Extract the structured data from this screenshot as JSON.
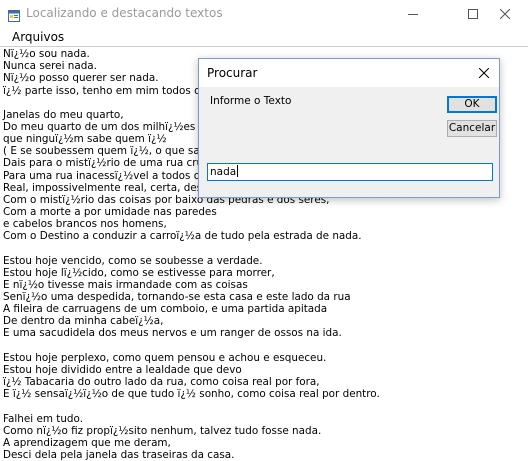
{
  "window": {
    "title": "Localizando e destacando textos",
    "icon": "app-form-icon"
  },
  "menu": {
    "items": [
      {
        "label": "Arquivos"
      }
    ]
  },
  "text_lines": [
    "Nï¿½o sou nada.",
    "Nunca serei nada.",
    "Nï¿½o posso querer ser nada.",
    "ï¿½ parte isso, tenho em mim todos os sonhos do m",
    "",
    "Janelas do meu quarto,",
    "Do meu quarto de um dos milhï¿½es do mundo.",
    "que ninguï¿½m sabe quem ï¿½",
    "( E se soubessem quem ï¿½, o que saberiam?),",
    "Dais para o mistï¿½rio de uma rua cruzada constan",
    "Para uma rua inacessï¿½vel a todos os pensament",
    "Real, impossivelmente real, certa, desconhecidan",
    "Com o mistï¿½rio das coisas por baixo das pedras e dos seres,",
    "Com a morte a por umidade nas paredes",
    "e cabelos brancos nos homens,",
    "Com o Destino a conduzir a carroï¿½a de tudo pela estrada de nada.",
    "",
    "Estou hoje vencido, como se soubesse a verdade.",
    "Estou hoje lï¿½cido, como se estivesse para morrer,",
    "E nï¿½o tivesse mais irmandade com as coisas",
    "Senï¿½o uma despedida, tornando-se esta casa e este lado da rua",
    "A fileira de carruagens de um comboio, e uma partida apitada",
    "De dentro da minha cabeï¿½a,",
    "E uma sacudidela dos meus nervos e um ranger de ossos na ida.",
    "",
    "Estou hoje perplexo, como quem pensou e achou e esqueceu.",
    "Estou hoje dividido entre a lealdade que devo",
    "ï¿½ Tabacaria do outro lado da rua, como coisa real por fora,",
    "E ï¿½ sensaï¿½ï¿½o de que tudo ï¿½ sonho, como coisa real por dentro.",
    "",
    "Falhei em tudo.",
    "Como nï¿½o fiz propï¿½sito nenhum, talvez tudo fosse nada.",
    "A aprendizagem que me deram,",
    "Desci dela pela janela das traseiras da casa."
  ],
  "dialog": {
    "title": "Procurar",
    "label": "Informe o Texto",
    "ok_label": "OK",
    "cancel_label": "Cancelar",
    "input_value": "nada"
  },
  "colors": {
    "accent": "#0078d7",
    "dialog_bg": "#f0f0f0",
    "button_bg": "#e1e1e1"
  }
}
